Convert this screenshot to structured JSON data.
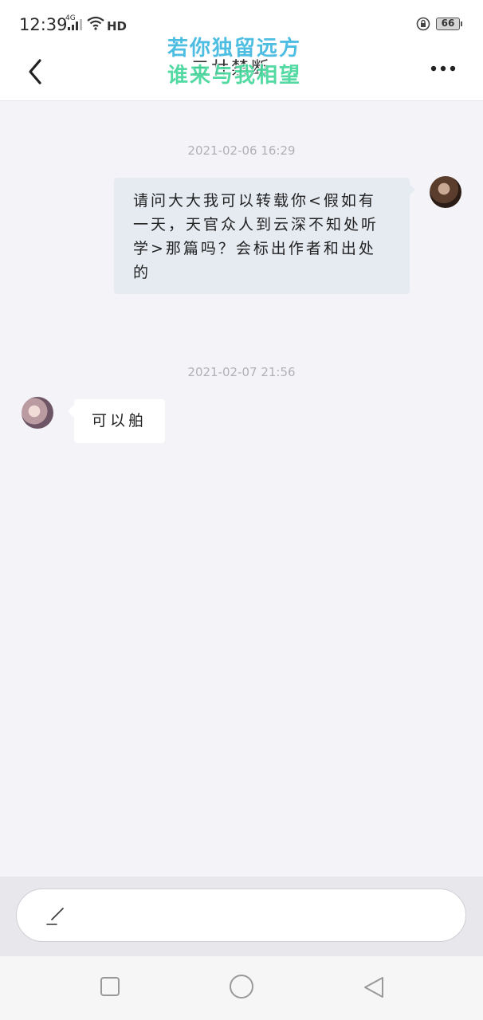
{
  "status_bar": {
    "time": "12:39",
    "network": "4G",
    "hd": "HD",
    "battery": "66"
  },
  "header": {
    "title": "三廿禁断",
    "watermark_line1": "若你独留远方",
    "watermark_line2": "谁来与我相望"
  },
  "messages": [
    {
      "timestamp": "2021-02-06 16:29",
      "side": "right",
      "text": "请问大大我可以转载你<假如有一天，天官众人到云深不知处听学>那篇吗？会标出作者和出处的"
    },
    {
      "timestamp": "2021-02-07 21:56",
      "side": "left",
      "text": "可以舶"
    }
  ],
  "composer": {
    "placeholder": ""
  },
  "icons": {
    "back": "back-arrow-icon",
    "more": "more-dots-icon",
    "pen": "pen-icon",
    "recent": "recent-apps-icon",
    "home": "home-icon",
    "back_nav": "back-triangle-icon"
  }
}
